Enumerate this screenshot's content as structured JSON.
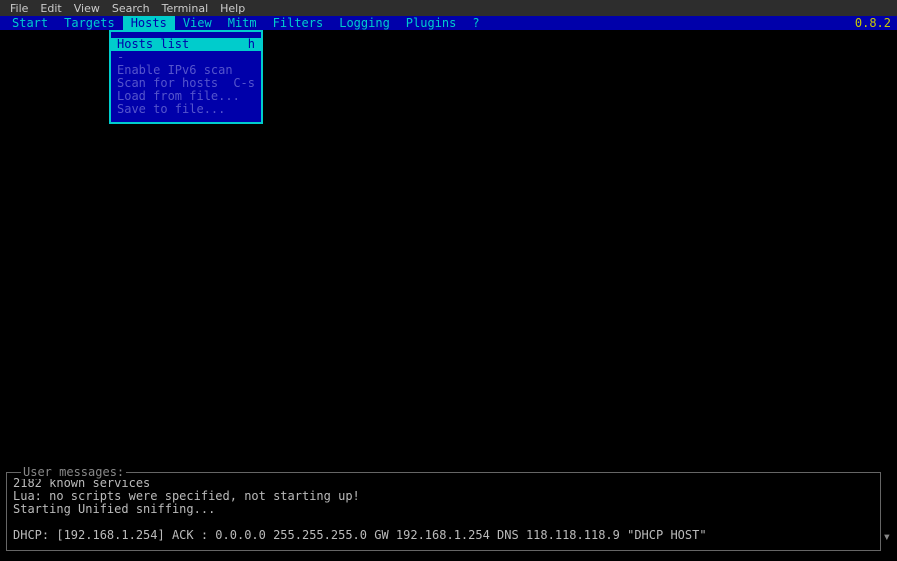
{
  "system_menu": {
    "items": [
      "File",
      "Edit",
      "View",
      "Search",
      "Terminal",
      "Help"
    ]
  },
  "app_menu": {
    "items": [
      "Start",
      "Targets",
      "Hosts",
      "View",
      "Mitm",
      "Filters",
      "Logging",
      "Plugins",
      "?"
    ],
    "highlighted_index": 2,
    "version": "0.8.2"
  },
  "dropdown": {
    "items": [
      {
        "label": "Hosts list",
        "shortcut": "h",
        "highlighted": true
      },
      {
        "label": "-",
        "separator": true
      },
      {
        "label": "Enable IPv6 scan",
        "shortcut": ""
      },
      {
        "label": "Scan for hosts",
        "shortcut": "C-s"
      },
      {
        "label": "Load from file...",
        "shortcut": ""
      },
      {
        "label": "Save to file...",
        "shortcut": ""
      }
    ]
  },
  "messages": {
    "title": "User messages:",
    "lines": [
      "2182 known services",
      "Lua: no scripts were specified, not starting up!",
      "Starting Unified sniffing...",
      "",
      "DHCP: [192.168.1.254] ACK : 0.0.0.0 255.255.255.0 GW 192.168.1.254 DNS 118.118.118.9 \"DHCP HOST\""
    ]
  }
}
